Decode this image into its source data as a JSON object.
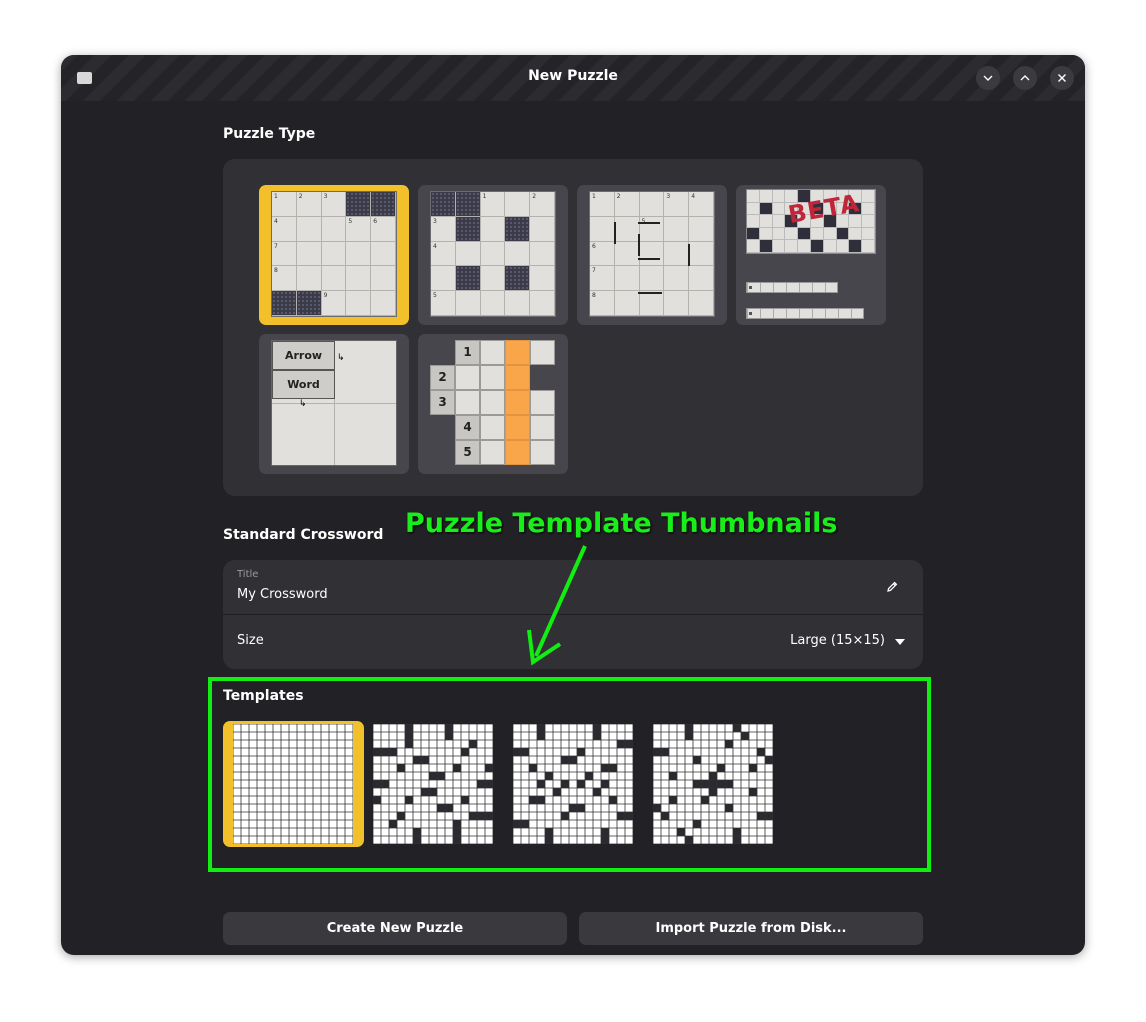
{
  "window": {
    "title": "New Puzzle"
  },
  "puzzle_type": {
    "heading": "Puzzle Type",
    "types": [
      {
        "name": "standard",
        "selected": true
      },
      {
        "name": "barred",
        "selected": false
      },
      {
        "name": "cryptic",
        "selected": false
      },
      {
        "name": "beta",
        "badge": "BETA",
        "selected": false
      },
      {
        "name": "arrowword",
        "clue1": "Arrow",
        "clue2": "Word",
        "selected": false
      },
      {
        "name": "acrostic",
        "numbers": [
          "1",
          "2",
          "3",
          "4",
          "5"
        ],
        "selected": false
      }
    ]
  },
  "form": {
    "heading": "Standard Crossword",
    "title_label": "Title",
    "title_value": "My Crossword",
    "size_label": "Size",
    "size_value": "Large (15×15)"
  },
  "templates": {
    "heading": "Templates",
    "items": [
      {
        "name": "blank",
        "selected": true
      },
      {
        "name": "template-1",
        "selected": false
      },
      {
        "name": "template-2",
        "selected": false
      },
      {
        "name": "template-3",
        "selected": false
      }
    ]
  },
  "buttons": {
    "create": "Create New Puzzle",
    "import": "Import Puzzle from Disk..."
  },
  "annotation": {
    "label": "Puzzle Template Thumbnails"
  },
  "colors": {
    "accent": "#f2c02a",
    "annotation": "#12ee12",
    "window_bg": "#222226",
    "panel_bg": "#303035"
  }
}
